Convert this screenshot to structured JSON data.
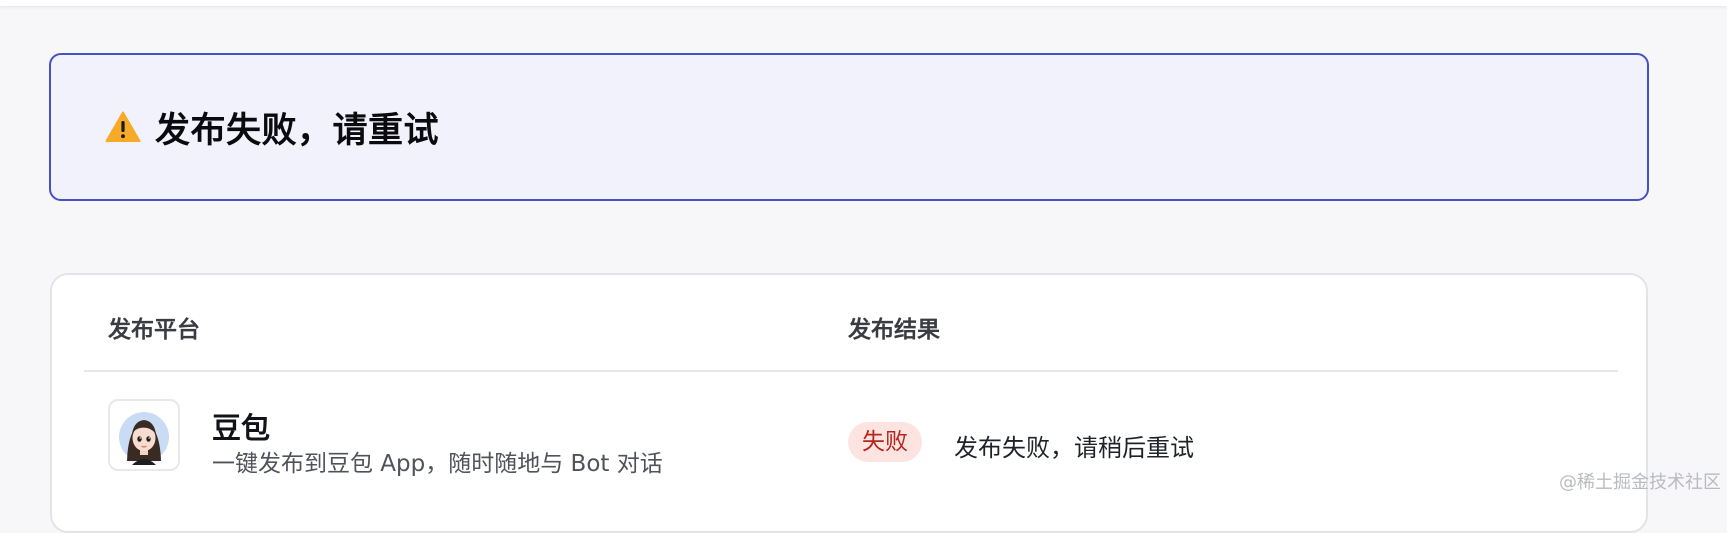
{
  "alert": {
    "icon": "warning-icon",
    "title": "发布失败，请重试",
    "accent_color": "#4b4fc4",
    "icon_color": "#f7a928"
  },
  "table": {
    "headers": {
      "platform": "发布平台",
      "result": "发布结果"
    },
    "rows": [
      {
        "platform_name": "豆包",
        "platform_desc": "一键发布到豆包 App，随时随地与 Bot 对话",
        "status": "失败",
        "status_color": "#b3261e",
        "message": "发布失败，请稍后重试"
      }
    ]
  },
  "watermark": "@稀土掘金技术社区"
}
